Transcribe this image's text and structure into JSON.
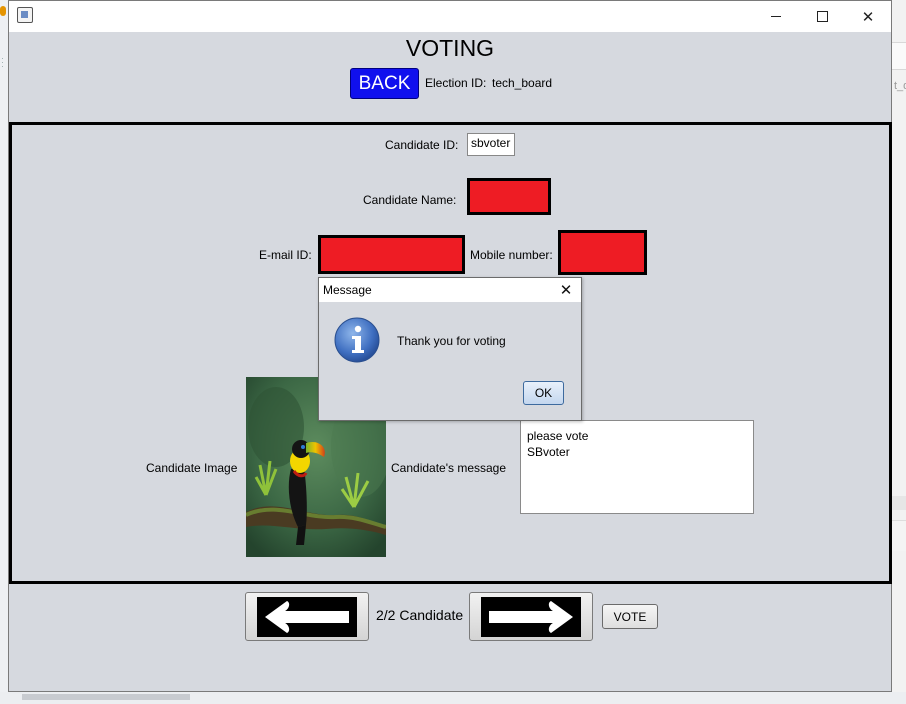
{
  "window": {
    "title": ""
  },
  "header": {
    "title": "VOTING",
    "back_label": "BACK",
    "election_id_label": "Election ID:",
    "election_id_value": "tech_board"
  },
  "form": {
    "candidate_id_label": "Candidate ID:",
    "candidate_id_value": "sbvoter",
    "candidate_name_label": "Candidate Name:",
    "email_label": "E-mail ID:",
    "mobile_label": "Mobile number:",
    "image_label": "Candidate Image",
    "message_label": "Candidate's message",
    "message_lines": [
      "please vote",
      "SBvoter"
    ],
    "redaction_color": "#ee1c24"
  },
  "navigation": {
    "counter": "2/2 Candidate",
    "vote_label": "VOTE"
  },
  "dialog": {
    "title": "Message",
    "message": "Thank you for voting",
    "ok_label": "OK",
    "icon": "info-icon"
  },
  "backdrop": {
    "right_fragment": "t_d"
  },
  "colors": {
    "back_button": "#1010ee",
    "window_bg": "#d6d9df"
  }
}
